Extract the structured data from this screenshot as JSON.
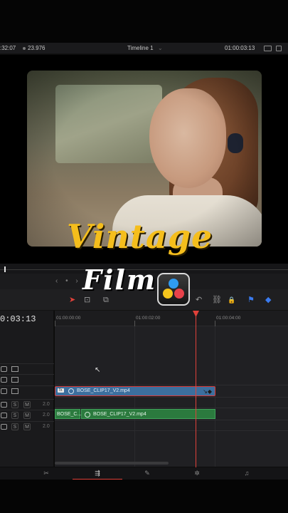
{
  "viewer_header": {
    "left_timecode": ":32:07",
    "fps": "23.976",
    "timeline_name": "Timeline 1",
    "right_timecode": "01:00:03:13"
  },
  "overlay": {
    "title": "Vintage",
    "subtitle": "Film",
    "logo_icon": "davinci-resolve-logo"
  },
  "transport": {
    "nav_glyphs": "‹ • ›"
  },
  "toolbar": {
    "tools": [
      {
        "name": "select-tool-icon",
        "glyph": "➤"
      },
      {
        "name": "trim-tool-icon",
        "glyph": "⊡"
      },
      {
        "name": "blade-tool-icon",
        "glyph": "⧉"
      },
      {
        "name": "snapping-icon",
        "glyph": "↶"
      },
      {
        "name": "link-icon",
        "glyph": "⛓"
      },
      {
        "name": "lock-icon",
        "glyph": "🔒"
      },
      {
        "name": "flag-icon",
        "glyph": "⚑"
      },
      {
        "name": "marker-icon",
        "glyph": "◆"
      }
    ]
  },
  "timeline": {
    "current_timecode": "0:03:13",
    "ruler_labels": [
      "01:00:00:00",
      "01:00:02:00",
      "01:00:04:00"
    ],
    "audio_volume_label": "2.0",
    "video_clip_name": "BOSE_CLIP17_V2.mp4",
    "audio_clip_short": "BOSE_C...",
    "audio_clip_name": "BOSE_CLIP17_V2.mp4",
    "playhead_fraction": 0.6
  },
  "pages": [
    {
      "name": "page-cut",
      "glyph": "✂",
      "active": false
    },
    {
      "name": "page-edit",
      "glyph": "⇶",
      "active": true
    },
    {
      "name": "page-fusion",
      "glyph": "✎",
      "active": false
    },
    {
      "name": "page-color",
      "glyph": "✲",
      "active": false
    },
    {
      "name": "page-fairlight",
      "glyph": "♫",
      "active": false
    }
  ],
  "colors": {
    "accent_red": "#e0413a",
    "video_clip": "#3c6f9e",
    "audio_clip": "#2b7a3e",
    "title_yellow": "#f5be1c"
  }
}
